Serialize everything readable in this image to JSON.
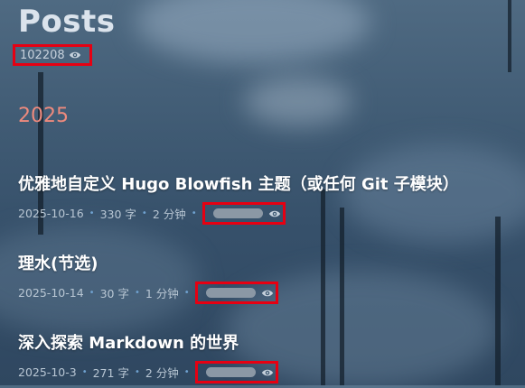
{
  "header": {
    "title": "Posts",
    "total_views": "102208",
    "views_icon": "eye-icon"
  },
  "year_group": "2025",
  "posts": [
    {
      "title": "优雅地自定义 Hugo Blowfish 主题（或任何 Git 子模块）",
      "date": "2025-10-16",
      "words": "330 字",
      "read_time": "2 分钟"
    },
    {
      "title": "理水(节选)",
      "date": "2025-10-14",
      "words": "30 字",
      "read_time": "1 分钟"
    },
    {
      "title": "深入探索 Markdown 的世界",
      "date": "2025-10-3",
      "words": "271 字",
      "read_time": "2 分钟"
    }
  ],
  "colors": {
    "accent_year": "#ee8a7d",
    "highlight_border": "#e60012",
    "meta_dot": "#6fa1cf"
  }
}
